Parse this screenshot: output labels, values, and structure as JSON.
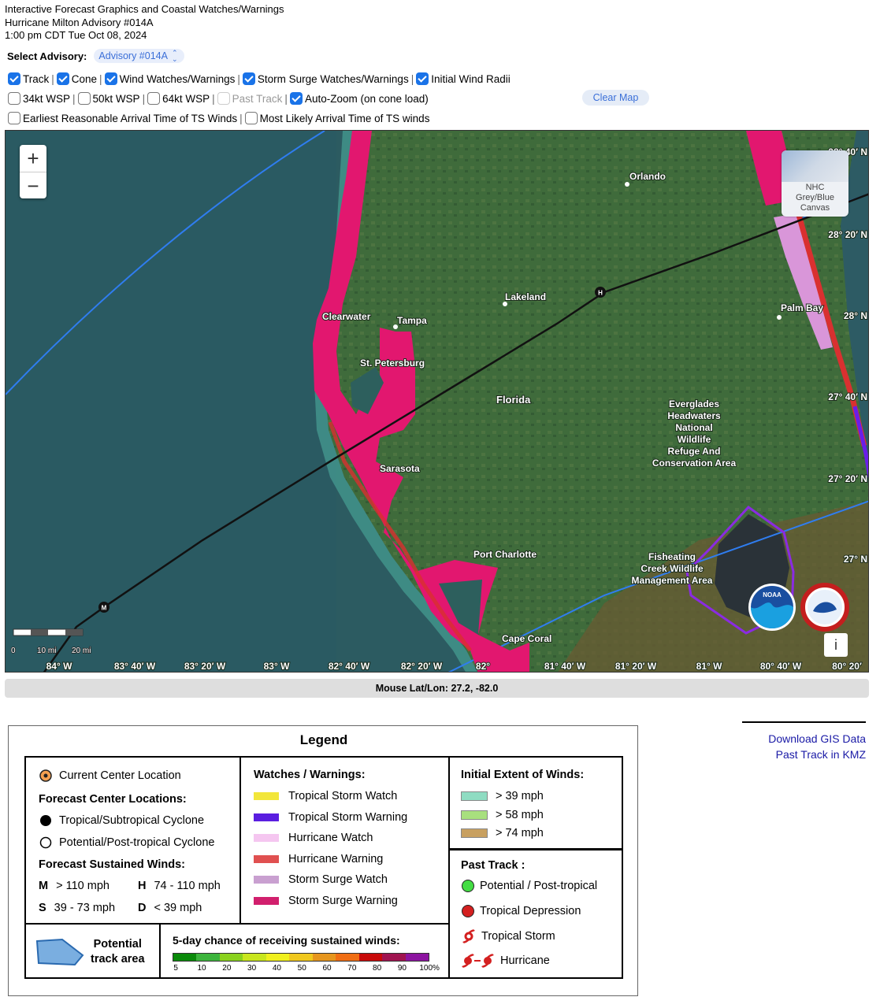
{
  "header": {
    "line1": "Interactive Forecast Graphics and Coastal Watches/Warnings",
    "line2": "Hurricane Milton Advisory #014A",
    "line3": "1:00 pm CDT Tue Oct 08, 2024"
  },
  "advisory": {
    "label": "Select Advisory:",
    "value": "Advisory #014A"
  },
  "options_row1": [
    {
      "label": "Track",
      "checked": true
    },
    {
      "label": "Cone",
      "checked": true
    },
    {
      "label": "Wind Watches/Warnings",
      "checked": true
    },
    {
      "label": "Storm Surge Watches/Warnings",
      "checked": true
    },
    {
      "label": "Initial Wind Radii",
      "checked": true
    }
  ],
  "options_row2": [
    {
      "label": "34kt WSP",
      "checked": false
    },
    {
      "label": "50kt WSP",
      "checked": false
    },
    {
      "label": "64kt WSP",
      "checked": false
    },
    {
      "label": "Past Track",
      "checked": false,
      "disabled": true
    },
    {
      "label": "Auto-Zoom (on cone load)",
      "checked": true
    }
  ],
  "options_row3": [
    {
      "label": "Earliest Reasonable Arrival Time of TS Winds",
      "checked": false
    },
    {
      "label": "Most Likely Arrival Time of TS winds",
      "checked": false
    }
  ],
  "separator": "|",
  "clear_map": "Clear Map",
  "map": {
    "zoom_in": "+",
    "zoom_out": "−",
    "basemap_label": [
      "NHC",
      "Grey/Blue",
      "Canvas"
    ],
    "info": "i",
    "places": {
      "orlando": "Orlando",
      "lakeland": "Lakeland",
      "tampa": "Tampa",
      "clearwater": "Clearwater",
      "st_petersburg": "St. Petersburg",
      "florida": "Florida",
      "sarasota": "Sarasota",
      "port_charlotte": "Port Charlotte",
      "cape_coral": "Cape Coral",
      "palm_bay": "Palm Bay",
      "everglades": [
        "Everglades",
        "Headwaters",
        "National",
        "Wildlife",
        "Refuge And",
        "Conservation Area"
      ],
      "fisheating": [
        "Fisheating",
        "Creek Wildlife",
        "Management Area"
      ]
    },
    "lon_labels": [
      "84° W",
      "83° 40′ W",
      "83° 20′ W",
      "83° W",
      "82° 40′ W",
      "82° 20′ W",
      "82°",
      "81° 40′ W",
      "81° 20′ W",
      "81° W",
      "80° 40′ W",
      "80° 20′"
    ],
    "lat_labels": [
      "28° 40′ N",
      "28° 20′ N",
      "28° N",
      "27° 40′ N",
      "27° 20′ N",
      "27° N"
    ],
    "track_markers": [
      "H",
      "M"
    ],
    "scale_labels": [
      "0",
      "10 mi",
      "20 mi"
    ],
    "logos": [
      "NOAA",
      "NATIONAL WEATHER SERVICE"
    ],
    "colors": {
      "land": "#3d6a3a",
      "water": "#2e5a5f",
      "storm_surge_warning": "#e2176f",
      "storm_surge_watch": "#d996d9",
      "hurricane_warning": "#d93030",
      "tropical_storm_warning": "#6a1ee8",
      "track": "#111111",
      "cone": "#2f7df0",
      "wind_radii": "#8a2be2"
    }
  },
  "mouse_readout": "Mouse Lat/Lon: 27.2, -82.0",
  "legend": {
    "title": "Legend",
    "current_center": "Current Center Location",
    "forecast_centers_title": "Forecast Center Locations:",
    "forecast_centers": [
      "Tropical/Subtropical Cyclone",
      "Potential/Post-tropical Cyclone"
    ],
    "winds_title": "Forecast Sustained Winds:",
    "winds": [
      {
        "code": "M",
        "text": "> 110 mph"
      },
      {
        "code": "H",
        "text": "74 - 110 mph"
      },
      {
        "code": "S",
        "text": "39 - 73 mph"
      },
      {
        "code": "D",
        "text": "< 39 mph"
      }
    ],
    "ww_title": "Watches / Warnings:",
    "ww": [
      {
        "label": "Tropical Storm Watch",
        "color": "#f2e63a"
      },
      {
        "label": "Tropical Storm Warning",
        "color": "#5a1ee0"
      },
      {
        "label": "Hurricane Watch",
        "color": "#f5c6f0"
      },
      {
        "label": "Hurricane Warning",
        "color": "#e05050"
      },
      {
        "label": "Storm Surge Watch",
        "color": "#c9a0d0"
      },
      {
        "label": "Storm Surge Warning",
        "color": "#d11f6d"
      }
    ],
    "extent_title": "Initial Extent of Winds:",
    "extent": [
      {
        "label": "> 39 mph",
        "color": "#8fdcc2"
      },
      {
        "label": "> 58 mph",
        "color": "#a8e07e"
      },
      {
        "label": "> 74 mph",
        "color": "#c8a060"
      }
    ],
    "past_title": "Past Track :",
    "past": [
      {
        "label": "Potential / Post-tropical",
        "color": "#44dd44"
      },
      {
        "label": "Tropical Depression",
        "color": "#d42020"
      },
      {
        "label": "Tropical Storm",
        "color": "#d42020"
      },
      {
        "label": "Hurricane",
        "color": "#d42020"
      }
    ],
    "potential_area": [
      "Potential",
      "track area"
    ],
    "wsp_title": "5-day chance of receiving sustained winds:",
    "wsp_ticks": [
      "5",
      "10",
      "20",
      "30",
      "40",
      "50",
      "60",
      "70",
      "80",
      "90",
      "100%"
    ],
    "wsp_colors": [
      "#0a8a0a",
      "#3cb43c",
      "#8ad21e",
      "#c8e61e",
      "#f0f01e",
      "#f0c81e",
      "#e6961e",
      "#f06e14",
      "#c80a0a",
      "#a01450",
      "#8c14a0"
    ]
  },
  "downloads": [
    "Download GIS Data",
    "Past Track in KMZ"
  ]
}
